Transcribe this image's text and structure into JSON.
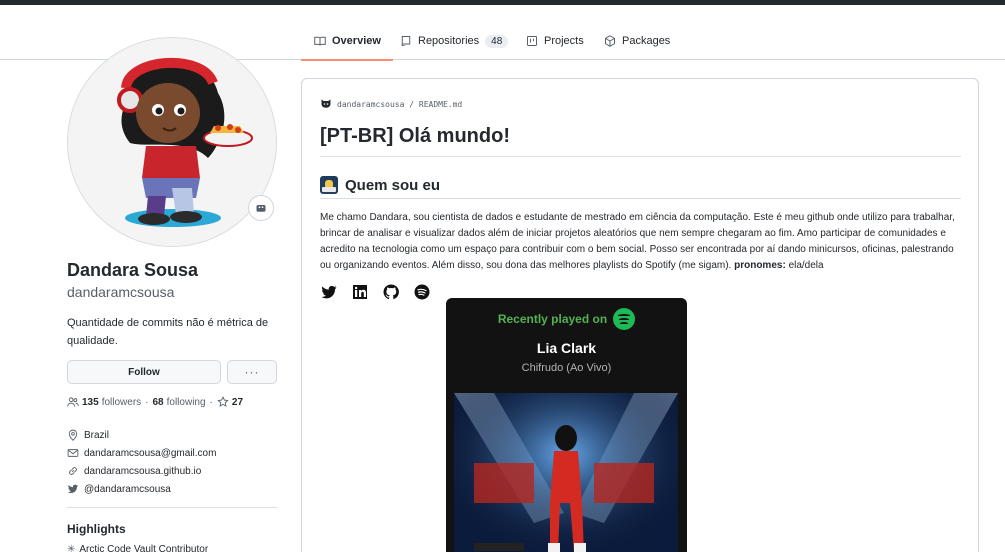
{
  "tabs": [
    {
      "label": "Overview",
      "icon": "book-icon",
      "active": true
    },
    {
      "label": "Repositories",
      "icon": "repo-icon",
      "count": "48"
    },
    {
      "label": "Projects",
      "icon": "project-icon"
    },
    {
      "label": "Packages",
      "icon": "package-icon"
    }
  ],
  "profile": {
    "name": "Dandara Sousa",
    "login": "dandaramcsousa",
    "bio": "Quantidade de commits não é métrica de qualidade.",
    "follow_label": "Follow",
    "more_label": "···",
    "followers_count": "135",
    "followers_label": "followers",
    "following_count": "68",
    "following_label": "following",
    "stars_count": "27",
    "location": "Brazil",
    "email": "dandaramcsousa@gmail.com",
    "website": "dandaramcsousa.github.io",
    "twitter": "@dandaramcsousa",
    "highlights_title": "Highlights",
    "highlight_item": "Arctic Code Vault Contributor"
  },
  "readme": {
    "path_user": "dandaramcsousa",
    "path_sep": " / ",
    "path_file": "README.md",
    "h1": "[PT-BR] Olá mundo!",
    "h2": "Quem sou eu",
    "paragraph": "Me chamo Dandara, sou cientista de dados e estudante de mestrado em ciência da computação. Este é meu github onde utilizo para trabalhar, brincar de analisar e visualizar dados além de iniciar projetos aleatórios que nem sempre chegaram ao fim. Amo participar de comunidades e acredito na tecnologia como um espaço para contribuir com o bem social. Posso ser encontrada por aí dando minicursos, oficinas, palestrando ou organizando eventos. Além disso, sou dona das melhores playlists do Spotify (me sigam).",
    "pronouns_label": "pronomes:",
    "pronouns_value": "ela/dela",
    "social_icons": [
      "twitter-icon",
      "linkedin-icon",
      "github-icon",
      "spotify-icon"
    ]
  },
  "spotify": {
    "title": "Recently played on",
    "artist": "Lia Clark",
    "track": "Chifrudo (Ao Vivo)"
  },
  "colors": {
    "tab_underline": "#fd8c73",
    "spotify_green": "#1db954",
    "spotify_bg": "#121212"
  }
}
